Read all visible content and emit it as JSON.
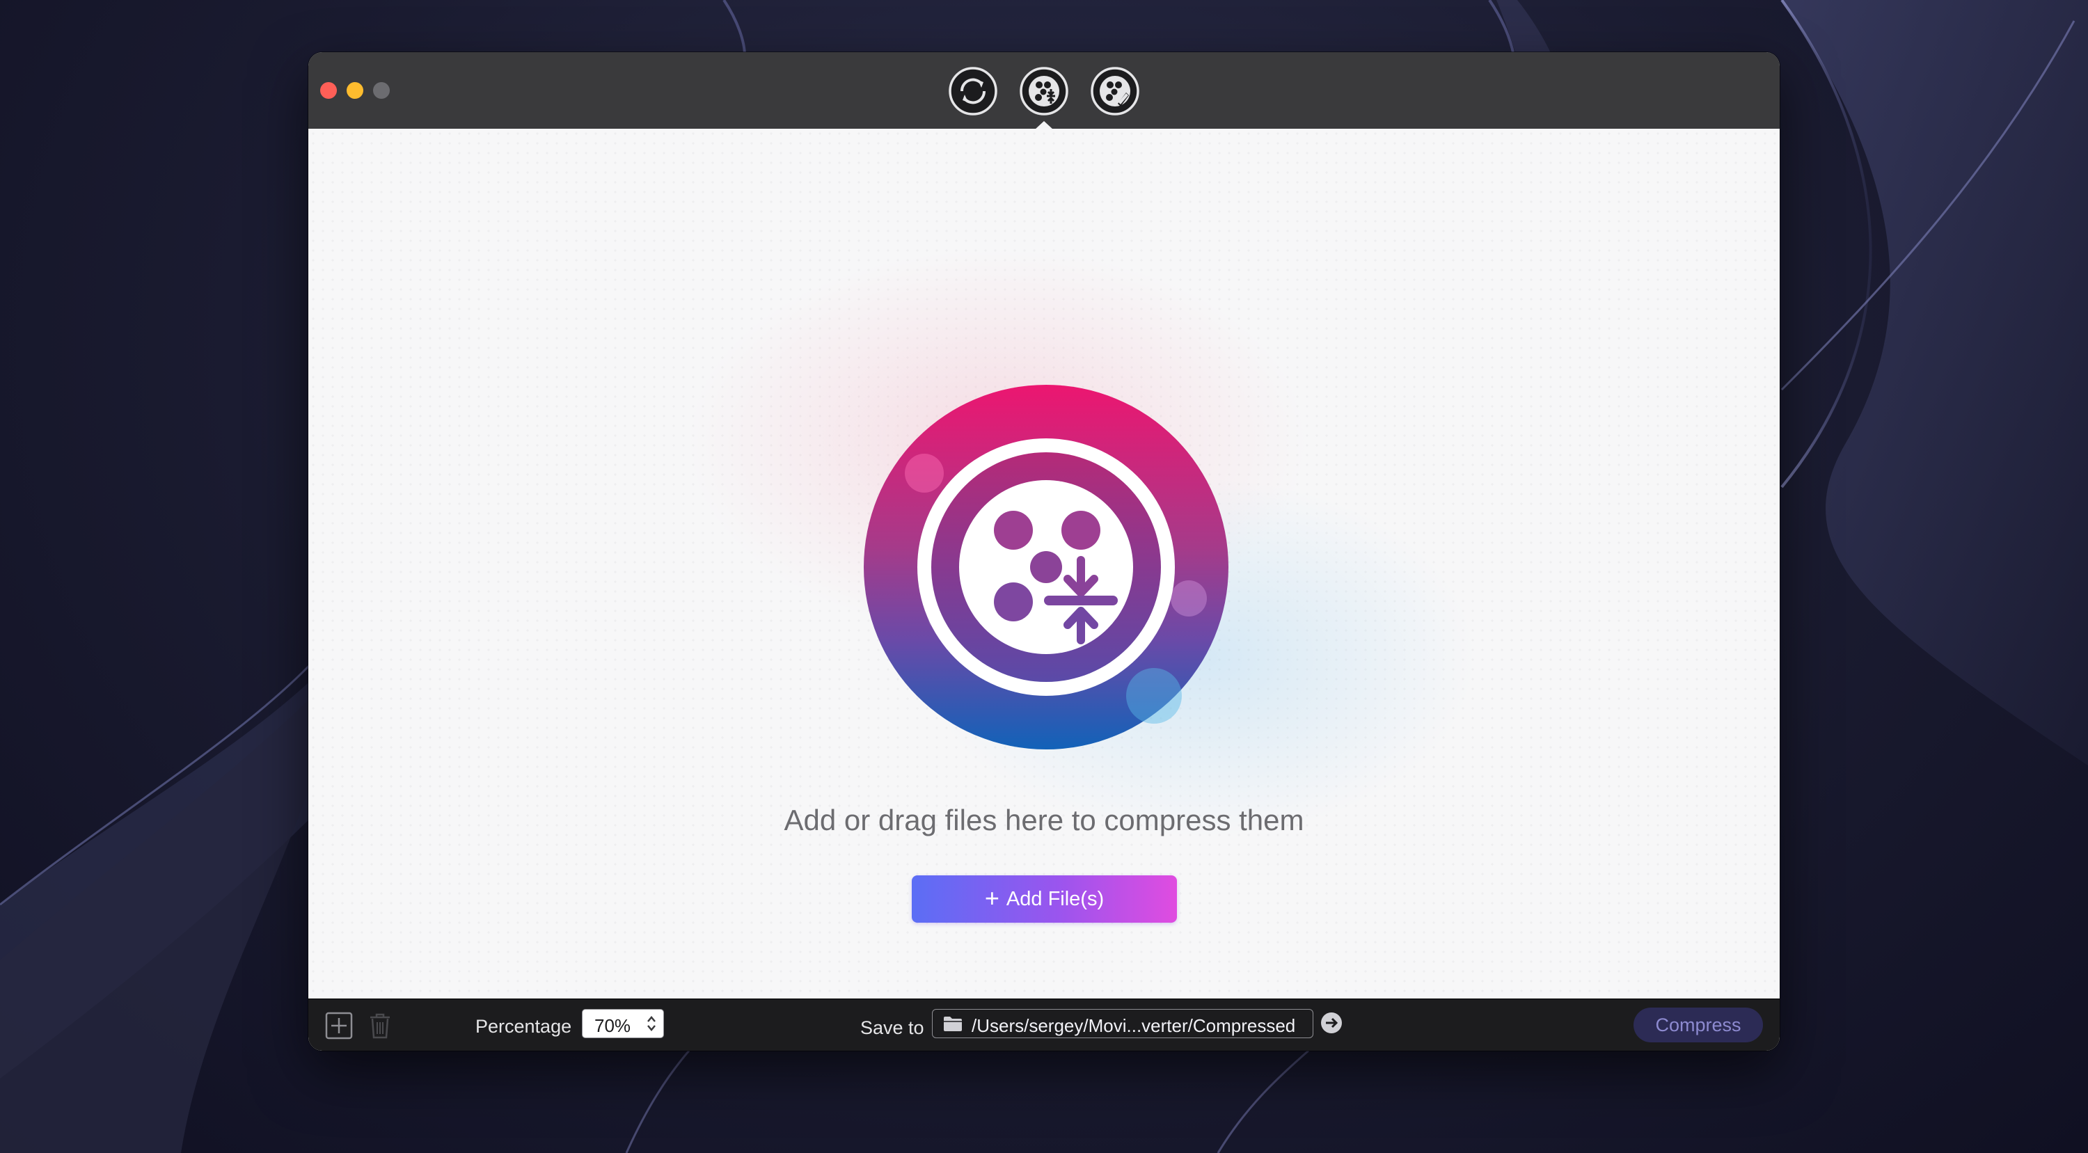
{
  "window": {
    "controls": [
      "close",
      "minimize",
      "maximize"
    ]
  },
  "toolbar": {
    "tools": [
      {
        "name": "convert",
        "icon": "convert-arrows-icon"
      },
      {
        "name": "compress",
        "icon": "compress-film-icon",
        "selected": true
      },
      {
        "name": "edit",
        "icon": "edit-film-icon"
      }
    ]
  },
  "main": {
    "logo_icon": "compress-film-reel-logo",
    "drop_text": "Add or drag files here to compress them",
    "add_button": {
      "icon": "plus-icon",
      "label": "Add File(s)"
    }
  },
  "bottombar": {
    "add_icon": "add-file-icon",
    "trash_icon": "trash-icon",
    "percentage_label": "Percentage",
    "percentage_value": "70%",
    "save_label": "Save to",
    "save_path": "/Users/sergey/Movi...verter/Compressed",
    "compress_label": "Compress"
  },
  "colors": {
    "titlebar": "#3a3a3c",
    "bottombar": "#1c1c1e",
    "add_button_gradient": [
      "#5b6ef5",
      "#e04ce0"
    ],
    "logo_gradient": [
      "#e8176f",
      "#7a3fa0",
      "#1563b8"
    ]
  }
}
